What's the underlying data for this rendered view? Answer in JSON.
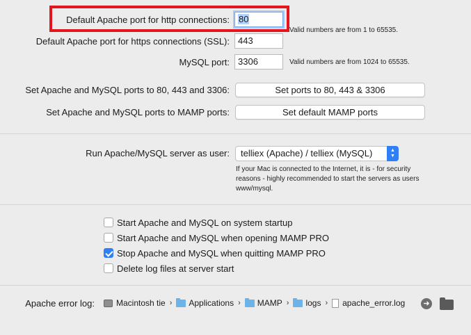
{
  "ports": {
    "http_label": "Default Apache port for http connections:",
    "http_value": "80",
    "http_hint": "Valid numbers are from 1 to 65535.",
    "https_label": "Default Apache port for https connections (SSL):",
    "https_value": "443",
    "mysql_label": "MySQL port:",
    "mysql_value": "3306",
    "mysql_hint": "Valid numbers are from 1024 to 65535."
  },
  "presets": {
    "set80_label": "Set Apache and MySQL ports to 80, 443 and 3306:",
    "set80_button": "Set ports to 80, 443 & 3306",
    "mamp_label": "Set Apache and MySQL ports to MAMP ports:",
    "mamp_button": "Set default MAMP ports"
  },
  "user": {
    "label": "Run Apache/MySQL server as user:",
    "selected": "telliex (Apache) / telliex (MySQL)",
    "note": "If your Mac is connected to the Internet, it is - for security reasons - highly recommended to start the servers as users www/mysql."
  },
  "options": [
    {
      "label": "Start Apache and MySQL on system startup",
      "checked": false
    },
    {
      "label": "Start Apache and MySQL when opening MAMP PRO",
      "checked": false
    },
    {
      "label": "Stop Apache and MySQL when quitting MAMP PRO",
      "checked": true
    },
    {
      "label": "Delete log files at server start",
      "checked": false
    }
  ],
  "error_log": {
    "label": "Apache error log:",
    "path": [
      "Macintosh tie",
      "Applications",
      "MAMP",
      "logs",
      "apache_error.log"
    ]
  },
  "colors": {
    "highlight": "#e4151c",
    "accent": "#2f7ff6"
  }
}
